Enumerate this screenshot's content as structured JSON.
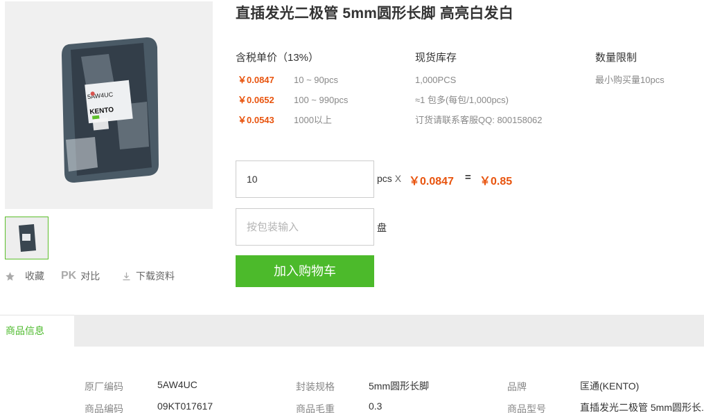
{
  "product": {
    "title": "直插发光二极管 5mm圆形长脚 高亮白发白",
    "image_brand_text": "KENTO",
    "image_model_text": "5AW4UC"
  },
  "actions": {
    "favorite": "收藏",
    "compare_badge": "PK",
    "compare": "对比",
    "download": "下载资料"
  },
  "pricing": {
    "header": "含税单价（13%）",
    "tiers": [
      {
        "price": "￥0.0847",
        "range": "10 ~ 90pcs"
      },
      {
        "price": "￥0.0652",
        "range": "100 ~ 990pcs"
      },
      {
        "price": "￥0.0543",
        "range": "1000以上"
      }
    ]
  },
  "stock": {
    "header": "现货库存",
    "quantity": "1,000PCS",
    "package": "≈1 包多(每包/1,000pcs)",
    "contact": "订货请联系客服QQ: 800158062"
  },
  "limit": {
    "header": "数量限制",
    "min": "最小购买量10pcs"
  },
  "order": {
    "qty_value": "10",
    "qty_unit": "pcs",
    "times": "X",
    "unit_price": "￥0.0847",
    "equals": "=",
    "total": "￥0.85",
    "pack_placeholder": "按包装输入",
    "pack_unit": "盘",
    "add_to_cart": "加入购物车"
  },
  "tabs": {
    "product_info": "商品信息"
  },
  "specs": [
    {
      "label": "原厂编码",
      "value": "5AW4UC"
    },
    {
      "label": "封装规格",
      "value": "5mm圆形长脚"
    },
    {
      "label": "品牌",
      "value": "匡通(KENTO)"
    },
    {
      "label": "商品编码",
      "value": "09KT017617"
    },
    {
      "label": "商品毛重",
      "value": "0.3"
    },
    {
      "label": "商品型号",
      "value": "直插发光二极管 5mm圆形长..."
    }
  ],
  "colors": {
    "accent_green": "#4cba2b",
    "price_orange": "#e8540e"
  }
}
